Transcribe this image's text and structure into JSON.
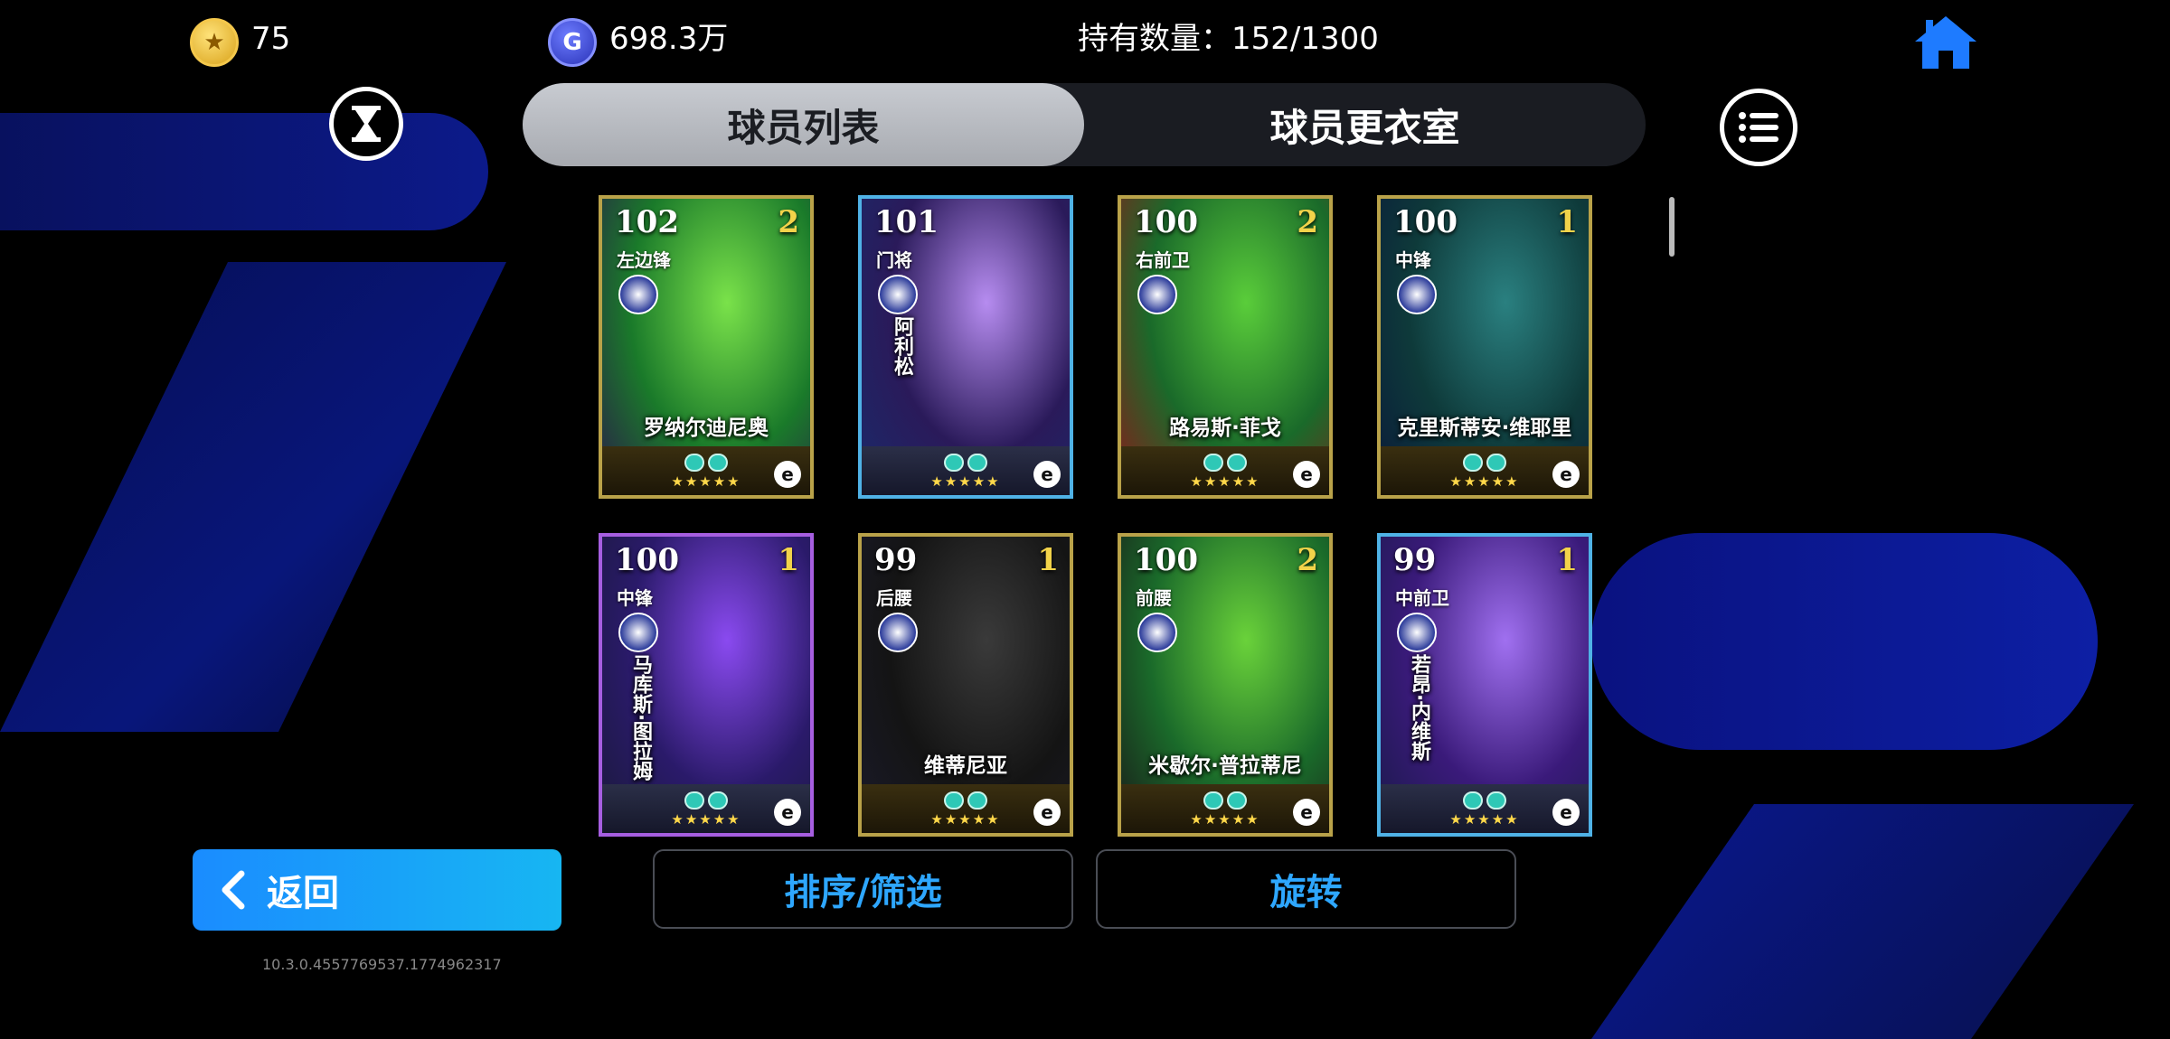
{
  "header": {
    "coins": "75",
    "gp": "698.3万",
    "owned_label": "持有数量：",
    "owned_count": "152/1300"
  },
  "tabs": [
    {
      "label": "球员列表",
      "active": true
    },
    {
      "label": "球员更衣室",
      "active": false
    }
  ],
  "cards": [
    {
      "rating": "102",
      "level": "2",
      "position": "左边锋",
      "name": "罗纳尔迪尼奥",
      "frame": "gold",
      "colors": [
        "#1a7a2a",
        "#7ae24a",
        "#2a1a4a"
      ]
    },
    {
      "rating": "101",
      "level": "",
      "position": "门将",
      "name": "阿利松",
      "frame": "blue",
      "colors": [
        "#2a1a5a",
        "#b68cf0",
        "#1a2a6a"
      ]
    },
    {
      "rating": "100",
      "level": "2",
      "position": "右前卫",
      "name": "路易斯·菲戈",
      "frame": "gold",
      "colors": [
        "#1a6a2a",
        "#5acd3a",
        "#8a1a1a"
      ]
    },
    {
      "rating": "100",
      "level": "1",
      "position": "中锋",
      "name": "克里斯蒂安·维耶里",
      "frame": "gold",
      "colors": [
        "#0e3a3a",
        "#2a8080",
        "#0a1a3a"
      ]
    },
    {
      "rating": "100",
      "level": "1",
      "position": "中锋",
      "name": "马库斯·图拉姆",
      "frame": "purple",
      "colors": [
        "#2a1a6a",
        "#8a4af0",
        "#1a1a3a"
      ]
    },
    {
      "rating": "99",
      "level": "1",
      "position": "后腰",
      "name": "维蒂尼亚",
      "frame": "gold",
      "colors": [
        "#141414",
        "#3a3a3a",
        "#1a1a2a"
      ]
    },
    {
      "rating": "100",
      "level": "2",
      "position": "前腰",
      "name": "米歇尔·普拉蒂尼",
      "frame": "gold",
      "colors": [
        "#1a6a2a",
        "#6ad23a",
        "#1a1a1a"
      ]
    },
    {
      "rating": "99",
      "level": "1",
      "position": "中前卫",
      "name": "若昂·内维斯",
      "frame": "blue",
      "colors": [
        "#3a1a7a",
        "#a070f0",
        "#1a1a4a"
      ]
    }
  ],
  "buttons": {
    "back": "返回",
    "sort": "排序/筛选",
    "rotate": "旋转"
  },
  "version": "10.3.0.4557769537.1774962317"
}
